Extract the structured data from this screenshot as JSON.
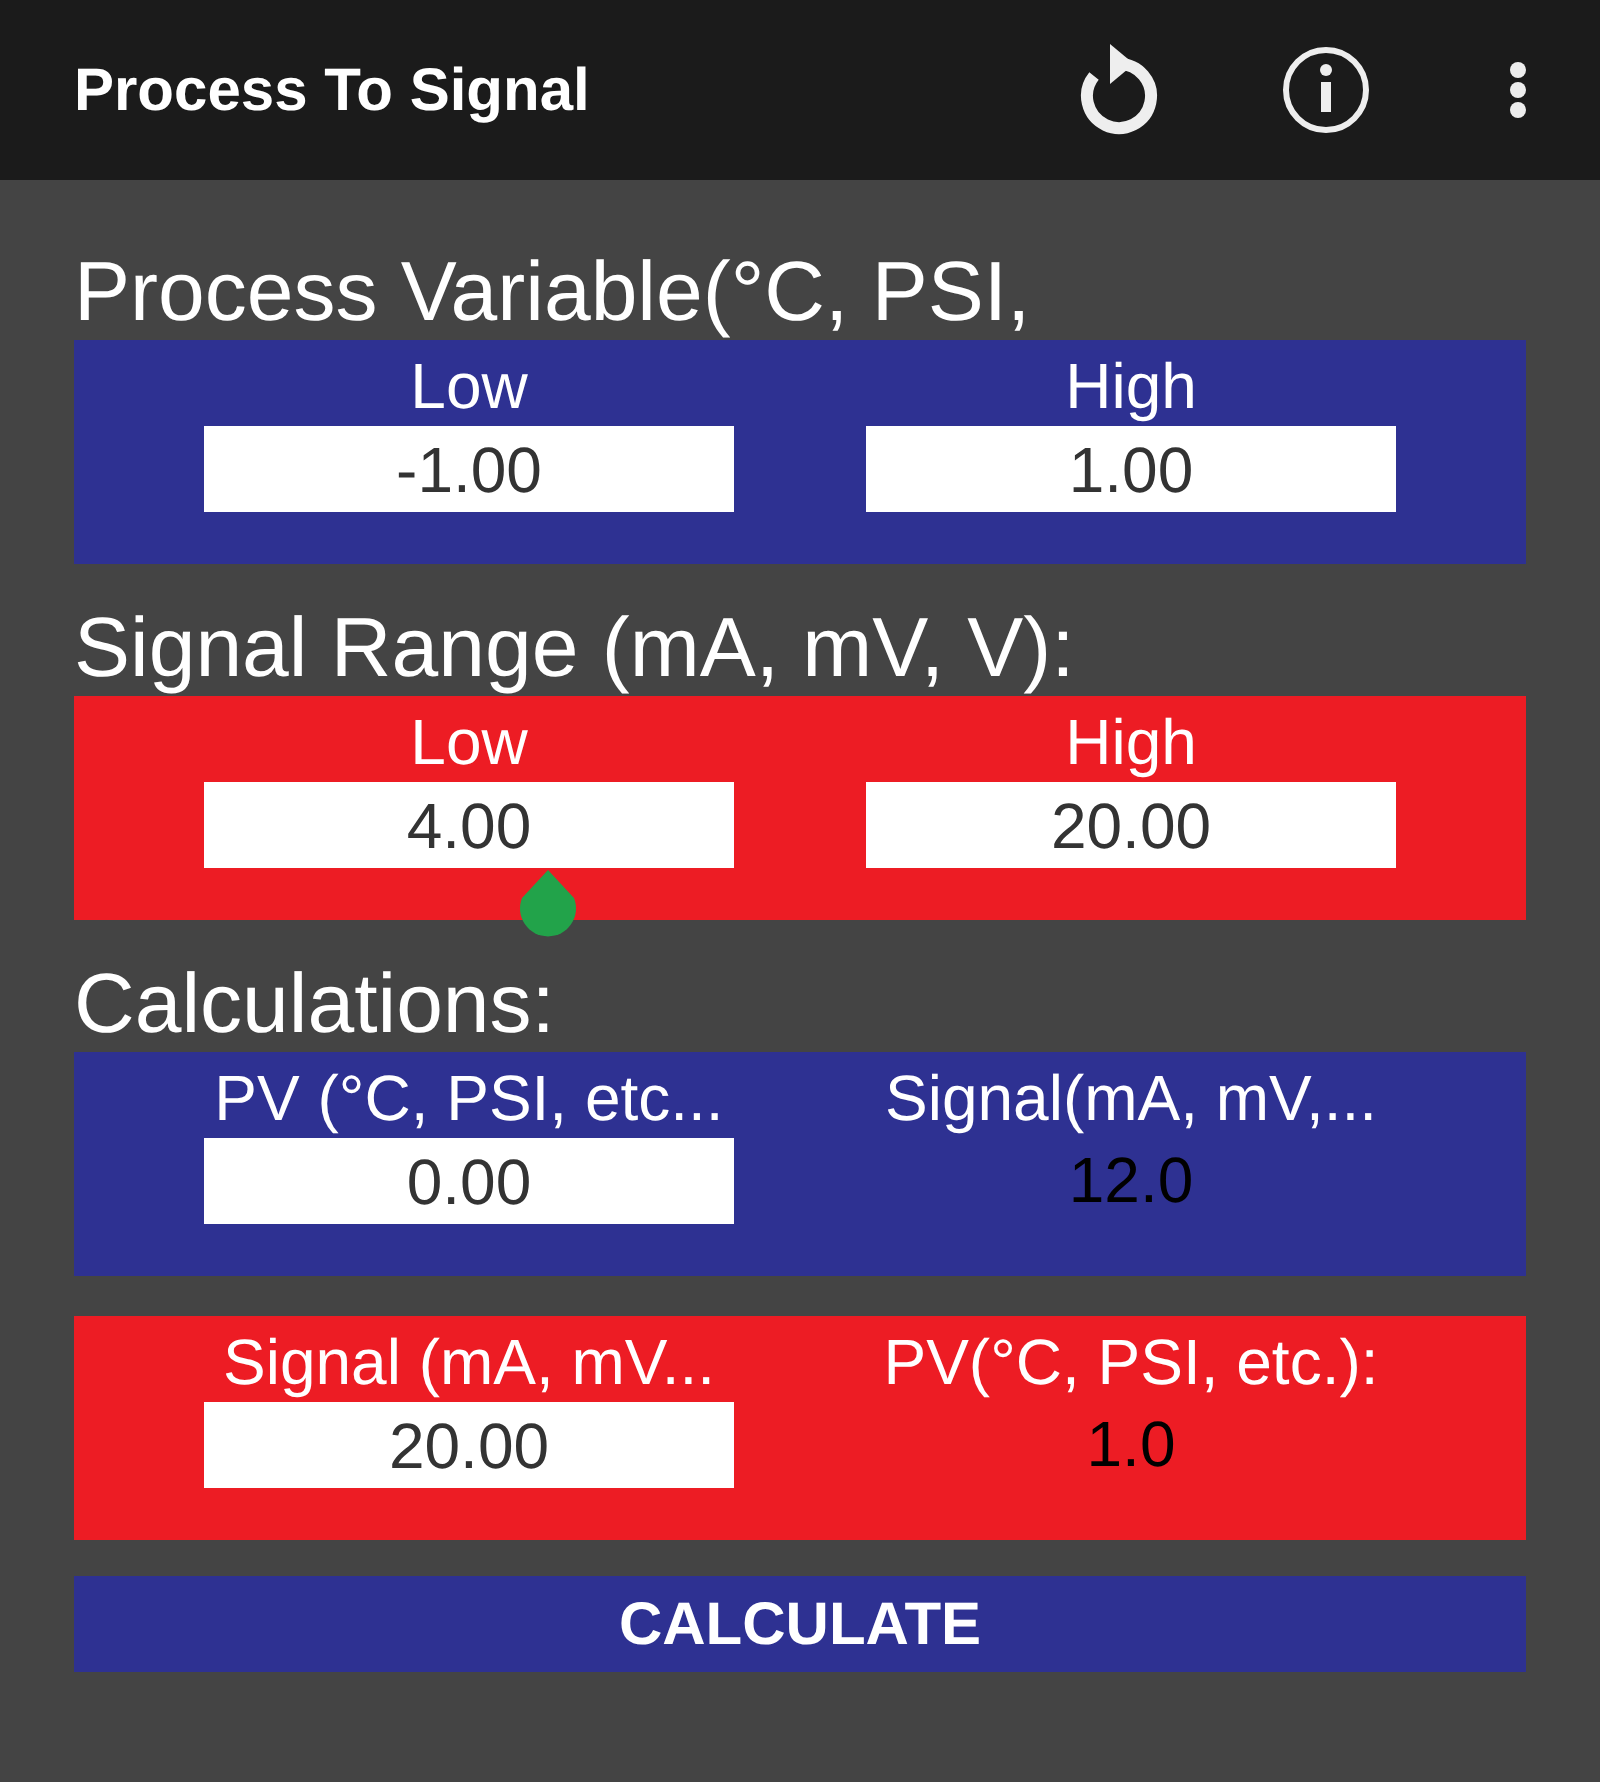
{
  "app_bar": {
    "title": "Process To Signal"
  },
  "sections": [
    {
      "title": "Process Variable(°C, PSI,",
      "panels": [
        {
          "color": "#2e3192",
          "fields": [
            {
              "kind": "input",
              "label": "Low",
              "value": "-1.00"
            },
            {
              "kind": "input",
              "label": "High",
              "value": "1.00"
            }
          ]
        }
      ]
    },
    {
      "title": "Signal Range (mA, mV, V):",
      "panels": [
        {
          "color": "#ed1c24",
          "fields": [
            {
              "kind": "input",
              "label": "Low",
              "value": "4.00",
              "focused": true
            },
            {
              "kind": "input",
              "label": "High",
              "value": "20.00"
            }
          ]
        }
      ]
    },
    {
      "title": "Calculations:",
      "panels": [
        {
          "color": "#2e3192",
          "fields": [
            {
              "kind": "input",
              "label": "PV (°C, PSI, etc...",
              "value": "0.00"
            },
            {
              "kind": "output",
              "label": "Signal(mA, mV,...",
              "value": "12.0"
            }
          ]
        },
        {
          "color": "#ed1c24",
          "fields": [
            {
              "kind": "input",
              "label": "Signal (mA, mV...",
              "value": "20.00"
            },
            {
              "kind": "output",
              "label": "PV(°C, PSI, etc.):",
              "value": "1.0"
            }
          ]
        }
      ]
    }
  ],
  "button": {
    "label": "CALCULATE"
  }
}
